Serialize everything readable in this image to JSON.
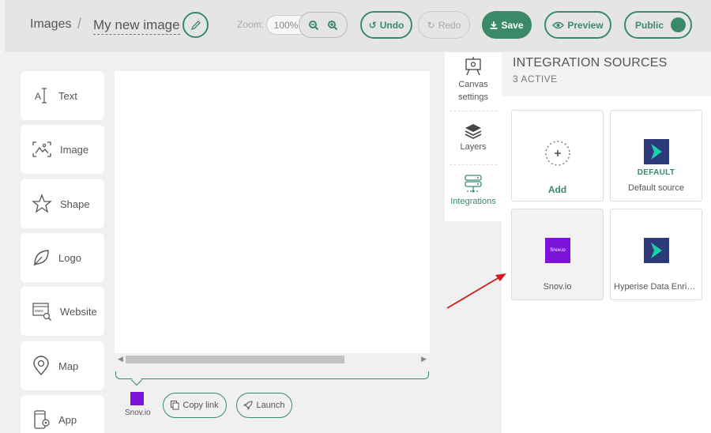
{
  "header": {
    "breadcrumb_root": "Images",
    "breadcrumb_sep": "/",
    "image_name": "My new image",
    "zoom_label": "Zoom:",
    "zoom_value": "100%",
    "undo_label": "Undo",
    "redo_label": "Redo",
    "save_label": "Save",
    "preview_label": "Preview",
    "public_label": "Public"
  },
  "tools": [
    {
      "label": "Text",
      "icon": "text-icon"
    },
    {
      "label": "Image",
      "icon": "image-icon"
    },
    {
      "label": "Shape",
      "icon": "star-icon"
    },
    {
      "label": "Logo",
      "icon": "leaf-icon"
    },
    {
      "label": "Website",
      "icon": "website-icon"
    },
    {
      "label": "Map",
      "icon": "map-pin-icon"
    },
    {
      "label": "App",
      "icon": "app-icon"
    }
  ],
  "canvas_footer": {
    "source_name": "Snov.io",
    "copy_link_label": "Copy link",
    "launch_label": "Launch"
  },
  "side_tabs": [
    {
      "label": "Canvas settings"
    },
    {
      "label": "Layers"
    },
    {
      "label": "Integrations"
    }
  ],
  "panel": {
    "title": "INTEGRATION SOURCES",
    "subtitle": "3 ACTIVE",
    "add_label": "Add",
    "cards": [
      {
        "badge": "DEFAULT",
        "name": "Default source"
      },
      {
        "name": "Snov.io",
        "logo_text": "Snov.io"
      },
      {
        "name": "Hyperise Data Enrichment"
      }
    ]
  },
  "colors": {
    "accent": "#3a8a6a",
    "snov": "#7c13d8",
    "hyperise": "#2d3a7a",
    "hyperise_arrow": "#19d1a6",
    "annotation_arrow": "#d11a1a"
  }
}
